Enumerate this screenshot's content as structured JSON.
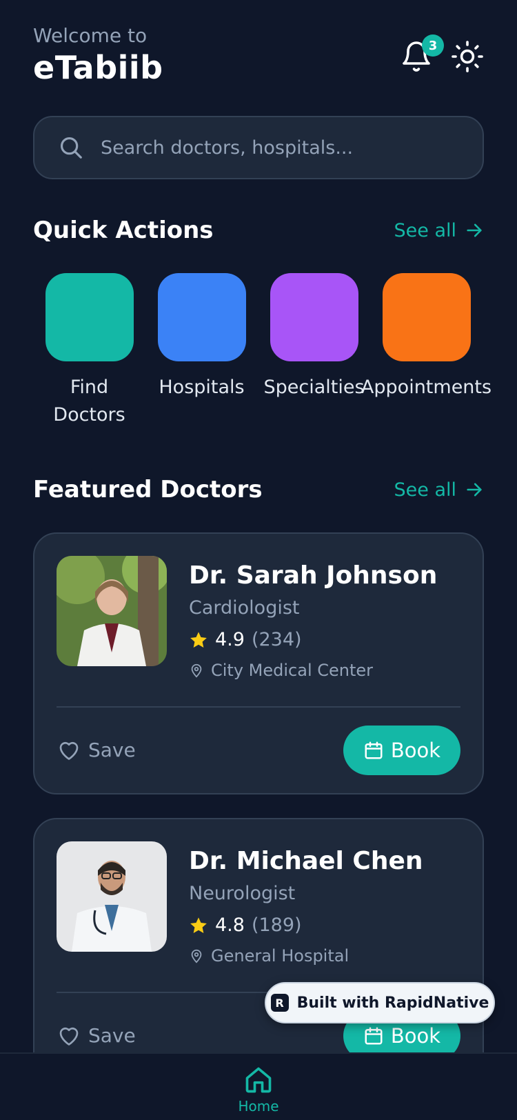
{
  "header": {
    "welcome": "Welcome to",
    "app_name": "eTabiib",
    "notification_count": "3",
    "icons": [
      "bell-icon",
      "sun-icon"
    ]
  },
  "search": {
    "placeholder": "Search doctors, hospitals..."
  },
  "quick_actions": {
    "title": "Quick Actions",
    "see_all": "See all",
    "items": [
      {
        "label": "Find\nDoctors",
        "color": "#14b8a6"
      },
      {
        "label": "Hospitals",
        "color": "#3b82f6"
      },
      {
        "label": "Specialties",
        "color": "#a855f7"
      },
      {
        "label": "Appointments",
        "color": "#f97316"
      }
    ]
  },
  "featured": {
    "title": "Featured Doctors",
    "see_all": "See all",
    "doctors": [
      {
        "name": "Dr. Sarah Johnson",
        "specialty": "Cardiologist",
        "rating": "4.9",
        "reviews": "(234)",
        "location": "City Medical Center",
        "save_label": "Save",
        "book_label": "Book"
      },
      {
        "name": "Dr. Michael Chen",
        "specialty": "Neurologist",
        "rating": "4.8",
        "reviews": "(189)",
        "location": "General Hospital",
        "save_label": "Save",
        "book_label": "Book"
      }
    ]
  },
  "floating_badge": {
    "text": "Built with RapidNative"
  },
  "bottom_nav": {
    "home_label": "Home"
  },
  "colors": {
    "background": "#0f172a",
    "card": "#1e293b",
    "accent": "#14b8a6",
    "star": "#facc15"
  }
}
